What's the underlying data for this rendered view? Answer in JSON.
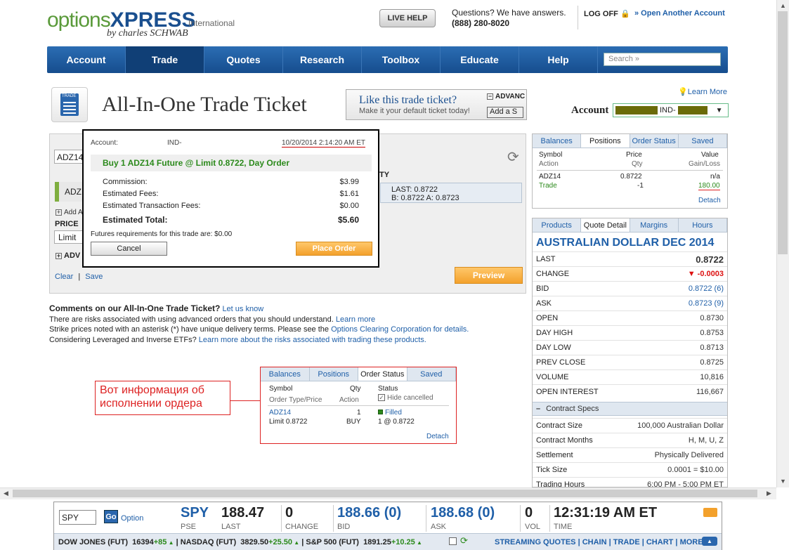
{
  "header": {
    "logo_main": "options",
    "logo_xpress": "XPRESS",
    "logo_by": "by charles SCHWAB",
    "logo_region": "International",
    "live_help": "LIVE HELP",
    "questions": "Questions? We have answers.",
    "phone": "(888) 280-8020",
    "logoff": "LOG OFF",
    "open_account": "» Open Another Account"
  },
  "nav": {
    "items": [
      "Account",
      "Trade",
      "Quotes",
      "Research",
      "Toolbox",
      "Educate",
      "Help"
    ],
    "active": "Trade",
    "search_placeholder": "Search »"
  },
  "title": {
    "icon_label": "TRADE",
    "text": "All-In-One Trade Ticket",
    "promo_heading": "Like this trade ticket?",
    "promo_sub": "Make it your default ticket today!",
    "promo_adv": "ADVANC",
    "promo_add": "Add a S",
    "learn_more": "Learn More",
    "account_label": "Account",
    "account_prefix": "IND-"
  },
  "ticket": {
    "symbol": "ADZ14",
    "symbol_row": "ADZ",
    "add_text": "Add A",
    "price_label": "PRICE",
    "price_type": "Limit",
    "advanced": "ADV",
    "clear": "Clear",
    "save": "Save",
    "qty_label": "TY",
    "quote_last": "LAST: 0.8722",
    "quote_ba": "B: 0.8722  A: 0.8723",
    "preview": "Preview"
  },
  "modal": {
    "account_label": "Account:",
    "account_value": "IND-",
    "datetime": "10/20/2014 2:14:20 AM ET",
    "headline": "Buy 1 ADZ14 Future @ Limit 0.8722, Day Order",
    "rows": [
      {
        "label": "Commission:",
        "value": "$3.99"
      },
      {
        "label": "Estimated Fees:",
        "value": "$1.61"
      },
      {
        "label": "Estimated Transaction Fees:",
        "value": "$0.00"
      }
    ],
    "total_label": "Estimated Total:",
    "total_value": "$5.60",
    "futures_req": "Futures requirements for this trade are: $0.00",
    "cancel": "Cancel",
    "place_order": "Place Order"
  },
  "comments": {
    "title": "Comments on our All-In-One Trade Ticket?",
    "title_link": "Let us know",
    "line1": "There are risks associated with using advanced orders that you should understand.",
    "line1_link": "Learn more",
    "line2": "Strike prices noted with an asterisk (*) have unique delivery terms. Please see the",
    "line2_link": "Options Clearing Corporation for details.",
    "line3": "Considering Leveraged and Inverse ETFs?",
    "line3_link": "Learn more about the risks associated with trading these products."
  },
  "annotation": {
    "text": "Вот информация об исполнении ордера"
  },
  "order_status_box": {
    "tabs": [
      "Balances",
      "Positions",
      "Order Status",
      "Saved"
    ],
    "active": "Order Status",
    "col_symbol": "Symbol",
    "col_type": "Order Type/Price",
    "col_qty": "Qty",
    "col_action": "Action",
    "col_status": "Status",
    "hide_cancelled": "Hide cancelled",
    "row_symbol": "ADZ14",
    "row_type": "Limit 0.8722",
    "row_qty": "1",
    "row_action": "BUY",
    "row_status": "Filled",
    "row_fill": "1 @ 0.8722",
    "detach": "Detach"
  },
  "positions_panel": {
    "tabs": [
      "Balances",
      "Positions",
      "Order Status",
      "Saved"
    ],
    "active": "Positions",
    "col_symbol": "Symbol",
    "col_action": "Action",
    "col_price": "Price",
    "col_qty": "Qty",
    "col_value": "Value",
    "col_gain": "Gain/Loss",
    "row_symbol": "ADZ14",
    "row_action": "Trade",
    "row_price": "0.8722",
    "row_qty": "-1",
    "row_value": "n/a",
    "row_gain": "180.00",
    "detach": "Detach"
  },
  "quote_detail": {
    "tabs": [
      "Products",
      "Quote Detail",
      "Margins",
      "Hours"
    ],
    "active": "Quote Detail",
    "title": "AUSTRALIAN DOLLAR DEC 2014",
    "rows": [
      {
        "label": "LAST",
        "value": "0.8722"
      },
      {
        "label": "CHANGE",
        "value": "▼ -0.0003"
      },
      {
        "label": "BID",
        "value": "0.8722 (6)"
      },
      {
        "label": "ASK",
        "value": "0.8723 (9)"
      },
      {
        "label": "OPEN",
        "value": "0.8730"
      },
      {
        "label": "DAY HIGH",
        "value": "0.8753"
      },
      {
        "label": "DAY LOW",
        "value": "0.8713"
      },
      {
        "label": "PREV CLOSE",
        "value": "0.8725"
      },
      {
        "label": "VOLUME",
        "value": "10,816"
      },
      {
        "label": "OPEN INTEREST",
        "value": "116,667"
      }
    ],
    "contract_specs": "Contract Specs",
    "specs": [
      {
        "label": "Contract Size",
        "value": "100,000 Australian Dollar"
      },
      {
        "label": "Contract Months",
        "value": "H, M, U, Z"
      },
      {
        "label": "Settlement",
        "value": "Physically Delivered"
      },
      {
        "label": "Tick Size",
        "value": "0.0001 = $10.00"
      },
      {
        "label": "Trading Hours",
        "value": "6:00 PM - 5:00 PM ET"
      }
    ]
  },
  "quote_bar": {
    "symbol_input": "SPY",
    "go": "Go",
    "option": "Option",
    "symbol": "SPY",
    "exchange": "PSE",
    "last": "188.47",
    "last_label": "LAST",
    "change": "0",
    "change_label": "CHANGE",
    "bid": "188.66 (0)",
    "bid_label": "BID",
    "ask": "188.68 (0)",
    "ask_label": "ASK",
    "vol": "0",
    "vol_label": "VOL",
    "time": "12:31:19 AM ET",
    "time_label": "TIME",
    "dow_label": "DOW JONES (FUT)",
    "dow_value": "16394",
    "dow_change": "+85",
    "nasdaq_label": "NASDAQ (FUT)",
    "nasdaq_value": "3829.50",
    "nasdaq_change": "+25.50",
    "sp_label": "S&P 500 (FUT)",
    "sp_value": "1891.25",
    "sp_change": "+10.25",
    "links": [
      "STREAMING QUOTES",
      "CHAIN",
      "TRADE",
      "CHART",
      "MORE"
    ]
  },
  "colors": {
    "nav_blue": "#1f5fa8",
    "accent_orange": "#f3a12c",
    "filled_green": "#2c8a1c",
    "annotation_red": "#dd2222"
  }
}
